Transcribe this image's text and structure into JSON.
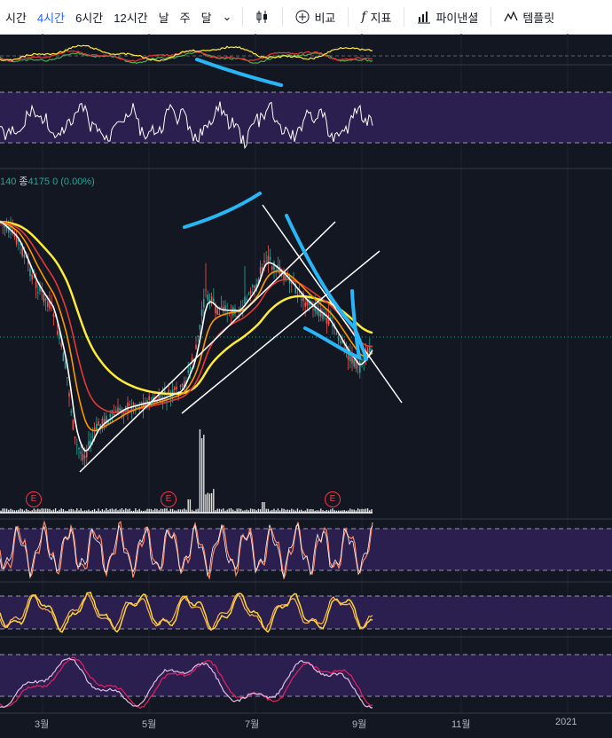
{
  "toolbar": {
    "timeframes": [
      "시간",
      "4시간",
      "6시간",
      "12시간",
      "날",
      "주",
      "달"
    ],
    "active_timeframe": "4시간",
    "chart_type_icon": "candles-icon",
    "compare_label": "비교",
    "indicators_label": "지표",
    "indicators_icon_text": "f",
    "chart_style_label": "파이낸셜",
    "templates_label": "템플릿"
  },
  "legend": {
    "prefix": "140",
    "close_label": "종",
    "close_value": "4175",
    "change": "0 (0.00%)"
  },
  "earnings_badges": [
    "E",
    "E",
    "E"
  ],
  "x_axis": {
    "labels": [
      "3월",
      "5월",
      "7월",
      "9월",
      "11월",
      "2021"
    ]
  },
  "colors": {
    "background": "#131722",
    "panel_band": "#2a1f4e",
    "ma_yellow": "#ffeb3b",
    "ma_red": "#e53935",
    "ma_orange": "#ff9800",
    "ma_white": "#ffffff",
    "drawing_blue": "#29b6f6",
    "price_teal": "#26a69a"
  }
}
